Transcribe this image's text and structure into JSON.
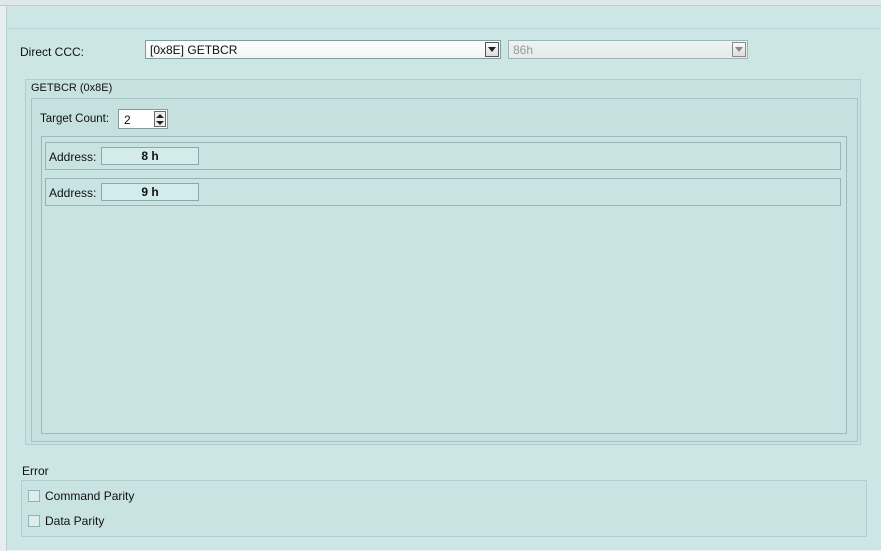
{
  "direct_ccc": {
    "label": "Direct CCC:",
    "selected": "[0x8E] GETBCR",
    "secondary_value": "86h"
  },
  "group": {
    "title": "GETBCR (0x8E)",
    "target_count_label": "Target Count:",
    "target_count_value": "2",
    "addresses": [
      {
        "label": "Address:",
        "value": "8 h"
      },
      {
        "label": "Address:",
        "value": "9 h"
      }
    ]
  },
  "error": {
    "title": "Error",
    "options": [
      {
        "label": "Command Parity",
        "checked": false
      },
      {
        "label": "Data Parity",
        "checked": false
      }
    ]
  }
}
